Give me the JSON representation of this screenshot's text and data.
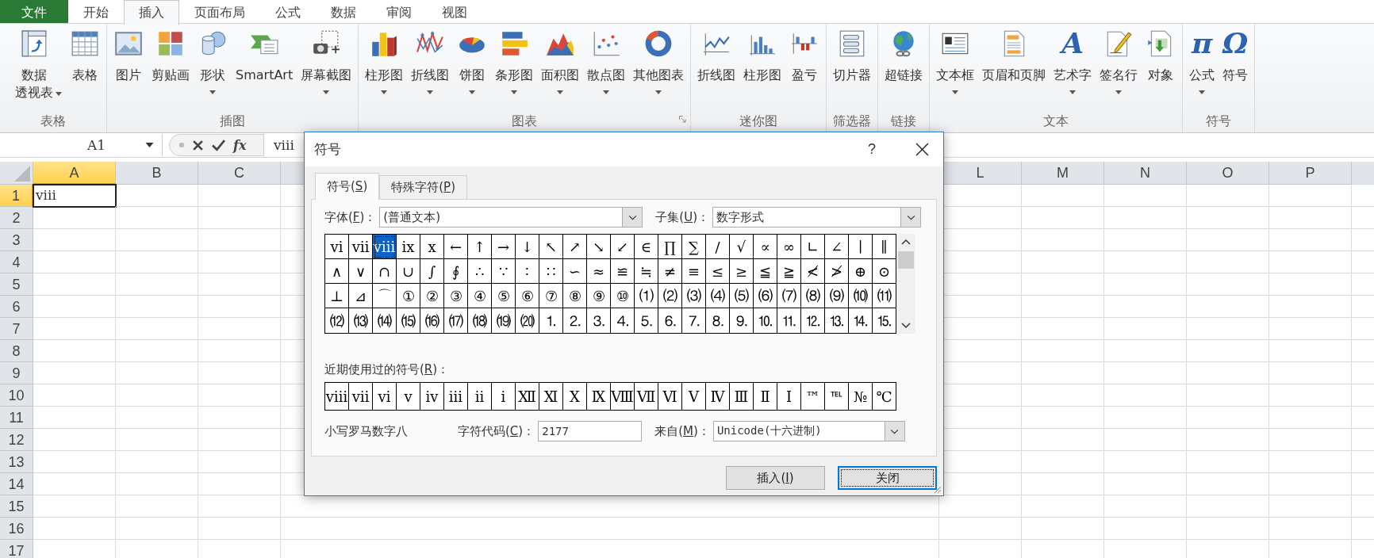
{
  "ribbon_tabs": [
    {
      "label": "文件",
      "kind": "file",
      "selected": false
    },
    {
      "label": "开始",
      "kind": "tab",
      "selected": false
    },
    {
      "label": "插入",
      "kind": "tab",
      "selected": true
    },
    {
      "label": "页面布局",
      "kind": "tab",
      "selected": false
    },
    {
      "label": "公式",
      "kind": "tab",
      "selected": false
    },
    {
      "label": "数据",
      "kind": "tab",
      "selected": false
    },
    {
      "label": "审阅",
      "kind": "tab",
      "selected": false
    },
    {
      "label": "视图",
      "kind": "tab",
      "selected": false
    }
  ],
  "ribbon_groups": [
    {
      "label": "表格",
      "launcher": false,
      "items": [
        {
          "label": "数据",
          "label_2": "透视表",
          "dropdown": true
        },
        {
          "label": "表格",
          "dropdown": false
        }
      ]
    },
    {
      "label": "插图",
      "launcher": false,
      "items": [
        {
          "label": "图片",
          "dropdown": false
        },
        {
          "label": "剪贴画",
          "dropdown": false
        },
        {
          "label": "形状",
          "dropdown": true
        },
        {
          "label": "SmartArt",
          "dropdown": false
        },
        {
          "label": "屏幕截图",
          "dropdown": true
        }
      ]
    },
    {
      "label": "图表",
      "launcher": true,
      "items": [
        {
          "label": "柱形图",
          "dropdown": true
        },
        {
          "label": "折线图",
          "dropdown": true
        },
        {
          "label": "饼图",
          "dropdown": true
        },
        {
          "label": "条形图",
          "dropdown": true
        },
        {
          "label": "面积图",
          "dropdown": true
        },
        {
          "label": "散点图",
          "dropdown": true
        },
        {
          "label": "其他图表",
          "dropdown": true
        }
      ]
    },
    {
      "label": "迷你图",
      "launcher": false,
      "items": [
        {
          "label": "折线图",
          "dropdown": false
        },
        {
          "label": "柱形图",
          "dropdown": false
        },
        {
          "label": "盈亏",
          "dropdown": false
        }
      ]
    },
    {
      "label": "筛选器",
      "launcher": false,
      "items": [
        {
          "label": "切片器",
          "dropdown": false
        }
      ]
    },
    {
      "label": "链接",
      "launcher": false,
      "items": [
        {
          "label": "超链接",
          "dropdown": false
        }
      ]
    },
    {
      "label": "文本",
      "launcher": false,
      "items": [
        {
          "label": "文本框",
          "dropdown": true
        },
        {
          "label": "页眉和页脚",
          "dropdown": false
        },
        {
          "label": "艺术字",
          "dropdown": true,
          "glyph": "A"
        },
        {
          "label": "签名行",
          "dropdown": true
        },
        {
          "label": "对象",
          "dropdown": false
        }
      ]
    },
    {
      "label": "符号",
      "launcher": false,
      "items": [
        {
          "label": "公式",
          "dropdown": true,
          "glyph": "π"
        },
        {
          "label": "符号",
          "dropdown": false,
          "glyph": "Ω"
        }
      ]
    }
  ],
  "formula_bar": {
    "name_box": "A1",
    "function_button": "fx",
    "value": "viii"
  },
  "sheet": {
    "columns_left": [
      {
        "label": "A",
        "selected": true
      },
      {
        "label": "B",
        "selected": false
      },
      {
        "label": "C",
        "selected": false
      }
    ],
    "columns_right": [
      {
        "label": "L",
        "selected": false
      },
      {
        "label": "M",
        "selected": false
      },
      {
        "label": "N",
        "selected": false
      },
      {
        "label": "O",
        "selected": false
      },
      {
        "label": "P",
        "selected": false
      }
    ],
    "rows": [
      {
        "label": "1",
        "selected": true
      },
      {
        "label": "2",
        "selected": false
      },
      {
        "label": "3",
        "selected": false
      },
      {
        "label": "4",
        "selected": false
      },
      {
        "label": "5",
        "selected": false
      },
      {
        "label": "6",
        "selected": false
      },
      {
        "label": "7",
        "selected": false
      },
      {
        "label": "8",
        "selected": false
      },
      {
        "label": "9",
        "selected": false
      },
      {
        "label": "10",
        "selected": false
      },
      {
        "label": "11",
        "selected": false
      },
      {
        "label": "12",
        "selected": false
      },
      {
        "label": "13",
        "selected": false
      },
      {
        "label": "14",
        "selected": false
      },
      {
        "label": "15",
        "selected": false
      },
      {
        "label": "16",
        "selected": false
      },
      {
        "label": "17",
        "selected": false
      }
    ],
    "active_cell_value": "viii"
  },
  "dialog": {
    "title": "符号",
    "help_button": "?",
    "tabs": [
      {
        "label": {
          "pre": "符号(",
          "key": "S",
          "post": ")"
        },
        "selected": true
      },
      {
        "label": {
          "pre": "特殊字符(",
          "key": "P",
          "post": ")"
        },
        "selected": false
      }
    ],
    "font_label": {
      "pre": "字体(",
      "key": "F",
      "post": ")："
    },
    "font_value": "(普通文本)",
    "subset_label": {
      "pre": "子集(",
      "key": "U",
      "post": ")："
    },
    "subset_value": "数字形式",
    "symbol_rows": [
      [
        {
          "s": "ⅵ",
          "selected": false
        },
        {
          "s": "ⅶ",
          "selected": false
        },
        {
          "s": "ⅷ",
          "selected": true
        },
        {
          "s": "ⅸ",
          "selected": false
        },
        {
          "s": "ⅹ",
          "selected": false
        },
        {
          "s": "←",
          "selected": false
        },
        {
          "s": "↑",
          "selected": false
        },
        {
          "s": "→",
          "selected": false
        },
        {
          "s": "↓",
          "selected": false
        },
        {
          "s": "↖",
          "selected": false
        },
        {
          "s": "↗",
          "selected": false
        },
        {
          "s": "↘",
          "selected": false
        },
        {
          "s": "↙",
          "selected": false
        },
        {
          "s": "∈",
          "selected": false
        },
        {
          "s": "∏",
          "selected": false
        },
        {
          "s": "∑",
          "selected": false
        },
        {
          "s": "∕",
          "selected": false
        },
        {
          "s": "√",
          "selected": false
        },
        {
          "s": "∝",
          "selected": false
        },
        {
          "s": "∞",
          "selected": false
        },
        {
          "s": "∟",
          "selected": false
        },
        {
          "s": "∠",
          "selected": false
        },
        {
          "s": "∣",
          "selected": false
        },
        {
          "s": "∥",
          "selected": false
        }
      ],
      [
        {
          "s": "∧",
          "selected": false
        },
        {
          "s": "∨",
          "selected": false
        },
        {
          "s": "∩",
          "selected": false
        },
        {
          "s": "∪",
          "selected": false
        },
        {
          "s": "∫",
          "selected": false
        },
        {
          "s": "∮",
          "selected": false
        },
        {
          "s": "∴",
          "selected": false
        },
        {
          "s": "∵",
          "selected": false
        },
        {
          "s": "∶",
          "selected": false
        },
        {
          "s": "∷",
          "selected": false
        },
        {
          "s": "∽",
          "selected": false
        },
        {
          "s": "≈",
          "selected": false
        },
        {
          "s": "≌",
          "selected": false
        },
        {
          "s": "≒",
          "selected": false
        },
        {
          "s": "≠",
          "selected": false
        },
        {
          "s": "≡",
          "selected": false
        },
        {
          "s": "≤",
          "selected": false
        },
        {
          "s": "≥",
          "selected": false
        },
        {
          "s": "≦",
          "selected": false
        },
        {
          "s": "≧",
          "selected": false
        },
        {
          "s": "≮",
          "selected": false
        },
        {
          "s": "≯",
          "selected": false
        },
        {
          "s": "⊕",
          "selected": false
        },
        {
          "s": "⊙",
          "selected": false
        }
      ],
      [
        {
          "s": "⊥",
          "selected": false
        },
        {
          "s": "⊿",
          "selected": false
        },
        {
          "s": "⌒",
          "selected": false
        },
        {
          "s": "①",
          "selected": false
        },
        {
          "s": "②",
          "selected": false
        },
        {
          "s": "③",
          "selected": false
        },
        {
          "s": "④",
          "selected": false
        },
        {
          "s": "⑤",
          "selected": false
        },
        {
          "s": "⑥",
          "selected": false
        },
        {
          "s": "⑦",
          "selected": false
        },
        {
          "s": "⑧",
          "selected": false
        },
        {
          "s": "⑨",
          "selected": false
        },
        {
          "s": "⑩",
          "selected": false
        },
        {
          "s": "⑴",
          "selected": false
        },
        {
          "s": "⑵",
          "selected": false
        },
        {
          "s": "⑶",
          "selected": false
        },
        {
          "s": "⑷",
          "selected": false
        },
        {
          "s": "⑸",
          "selected": false
        },
        {
          "s": "⑹",
          "selected": false
        },
        {
          "s": "⑺",
          "selected": false
        },
        {
          "s": "⑻",
          "selected": false
        },
        {
          "s": "⑼",
          "selected": false
        },
        {
          "s": "⑽",
          "selected": false
        },
        {
          "s": "⑾",
          "selected": false
        }
      ],
      [
        {
          "s": "⑿",
          "selected": false
        },
        {
          "s": "⒀",
          "selected": false
        },
        {
          "s": "⒁",
          "selected": false
        },
        {
          "s": "⒂",
          "selected": false
        },
        {
          "s": "⒃",
          "selected": false
        },
        {
          "s": "⒄",
          "selected": false
        },
        {
          "s": "⒅",
          "selected": false
        },
        {
          "s": "⒆",
          "selected": false
        },
        {
          "s": "⒇",
          "selected": false
        },
        {
          "s": "⒈",
          "selected": false
        },
        {
          "s": "⒉",
          "selected": false
        },
        {
          "s": "⒊",
          "selected": false
        },
        {
          "s": "⒋",
          "selected": false
        },
        {
          "s": "⒌",
          "selected": false
        },
        {
          "s": "⒍",
          "selected": false
        },
        {
          "s": "⒎",
          "selected": false
        },
        {
          "s": "⒏",
          "selected": false
        },
        {
          "s": "⒐",
          "selected": false
        },
        {
          "s": "⒑",
          "selected": false
        },
        {
          "s": "⒒",
          "selected": false
        },
        {
          "s": "⒓",
          "selected": false
        },
        {
          "s": "⒔",
          "selected": false
        },
        {
          "s": "⒕",
          "selected": false
        },
        {
          "s": "⒖",
          "selected": false
        }
      ]
    ],
    "recent_label": {
      "pre": "近期使用过的符号(",
      "key": "R",
      "post": ")："
    },
    "recent_symbols": [
      "ⅷ",
      "ⅶ",
      "ⅵ",
      "ⅴ",
      "ⅳ",
      "ⅲ",
      "ⅱ",
      "ⅰ",
      "Ⅻ",
      "Ⅺ",
      "Ⅹ",
      "Ⅸ",
      "Ⅷ",
      "Ⅶ",
      "Ⅵ",
      "Ⅴ",
      "Ⅳ",
      "Ⅲ",
      "Ⅱ",
      "Ⅰ",
      "™",
      "℡",
      "№",
      "℃"
    ],
    "symbol_name": "小写罗马数字八",
    "code_label": {
      "pre": "字符代码(",
      "key": "C",
      "post": ")："
    },
    "code_value": "2177",
    "from_label": {
      "pre": "来自(",
      "key": "M",
      "post": ")："
    },
    "from_value": "Unicode(十六进制)",
    "buttons": [
      {
        "label": {
          "pre": "插入(",
          "key": "I",
          "post": ")"
        },
        "default": false
      },
      {
        "label": {
          "pre": "关闭"
        },
        "default": true
      }
    ]
  }
}
